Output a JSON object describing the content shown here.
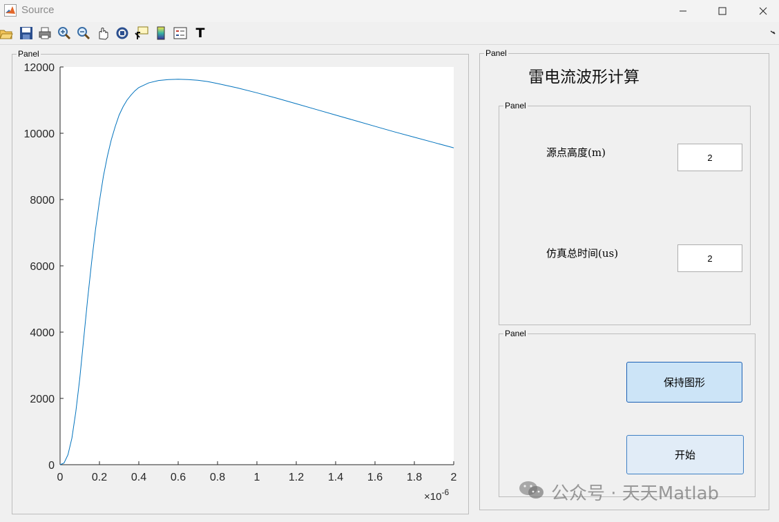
{
  "window": {
    "title": "Source",
    "controls": [
      "minimize",
      "maximize",
      "close"
    ]
  },
  "toolbar": {
    "tools": [
      "open-icon",
      "save-icon",
      "print-icon",
      "zoom-in-icon",
      "zoom-out-icon",
      "pan-icon",
      "rotate-3d-icon",
      "data-cursor-icon",
      "colorbar-icon",
      "legend-icon",
      "insert-text-icon"
    ],
    "text_tool_glyph": "T"
  },
  "panels": {
    "plot_panel": {
      "label": "Panel"
    },
    "right_panel": {
      "label": "Panel"
    },
    "params_panel": {
      "label": "Panel"
    },
    "buttons_panel": {
      "label": "Panel"
    }
  },
  "app": {
    "title": "雷电流波形计算"
  },
  "inputs": {
    "source_height": {
      "label": "源点高度(m)",
      "value": "2"
    },
    "sim_time": {
      "label": "仿真总时间(us)",
      "value": "2"
    }
  },
  "buttons": {
    "hold": {
      "label": "保持图形",
      "color": "#cce4f7"
    },
    "start": {
      "label": "开始",
      "color": "#e1ecf7"
    }
  },
  "watermark": {
    "text": "公众号 · 天天Matlab"
  },
  "chart_data": {
    "type": "line",
    "x_exponent_label": "×10",
    "x_exponent_power": "-6",
    "xlim": [
      0,
      2
    ],
    "ylim": [
      0,
      12000
    ],
    "xticks": [
      0,
      0.2,
      0.4,
      0.6,
      0.8,
      1,
      1.2,
      1.4,
      1.6,
      1.8,
      2
    ],
    "xtick_labels": [
      "0",
      "0.2",
      "0.4",
      "0.6",
      "0.8",
      "1",
      "1.2",
      "1.4",
      "1.6",
      "1.8",
      "2"
    ],
    "yticks": [
      0,
      2000,
      4000,
      6000,
      8000,
      10000,
      12000
    ],
    "ytick_labels": [
      "0",
      "2000",
      "4000",
      "6000",
      "8000",
      "10000",
      "12000"
    ],
    "grid": false,
    "line_color": "#0072bd",
    "series": [
      {
        "x": [
          0,
          0.02,
          0.04,
          0.06,
          0.08,
          0.1,
          0.12,
          0.14,
          0.16,
          0.18,
          0.2,
          0.22,
          0.24,
          0.26,
          0.28,
          0.3,
          0.32,
          0.34,
          0.36,
          0.38,
          0.4,
          0.45,
          0.5,
          0.55,
          0.6,
          0.65,
          0.7,
          0.75,
          0.8,
          0.9,
          1.0,
          1.1,
          1.2,
          1.3,
          1.4,
          1.5,
          1.6,
          1.7,
          1.8,
          1.9,
          2.0
        ],
        "y": [
          0,
          50,
          300,
          800,
          1600,
          2600,
          3800,
          5000,
          6100,
          7100,
          7950,
          8700,
          9300,
          9800,
          10200,
          10550,
          10800,
          11000,
          11150,
          11280,
          11380,
          11520,
          11590,
          11620,
          11630,
          11620,
          11600,
          11560,
          11500,
          11370,
          11220,
          11060,
          10890,
          10720,
          10550,
          10380,
          10210,
          10040,
          9880,
          9720,
          9560
        ]
      }
    ]
  }
}
